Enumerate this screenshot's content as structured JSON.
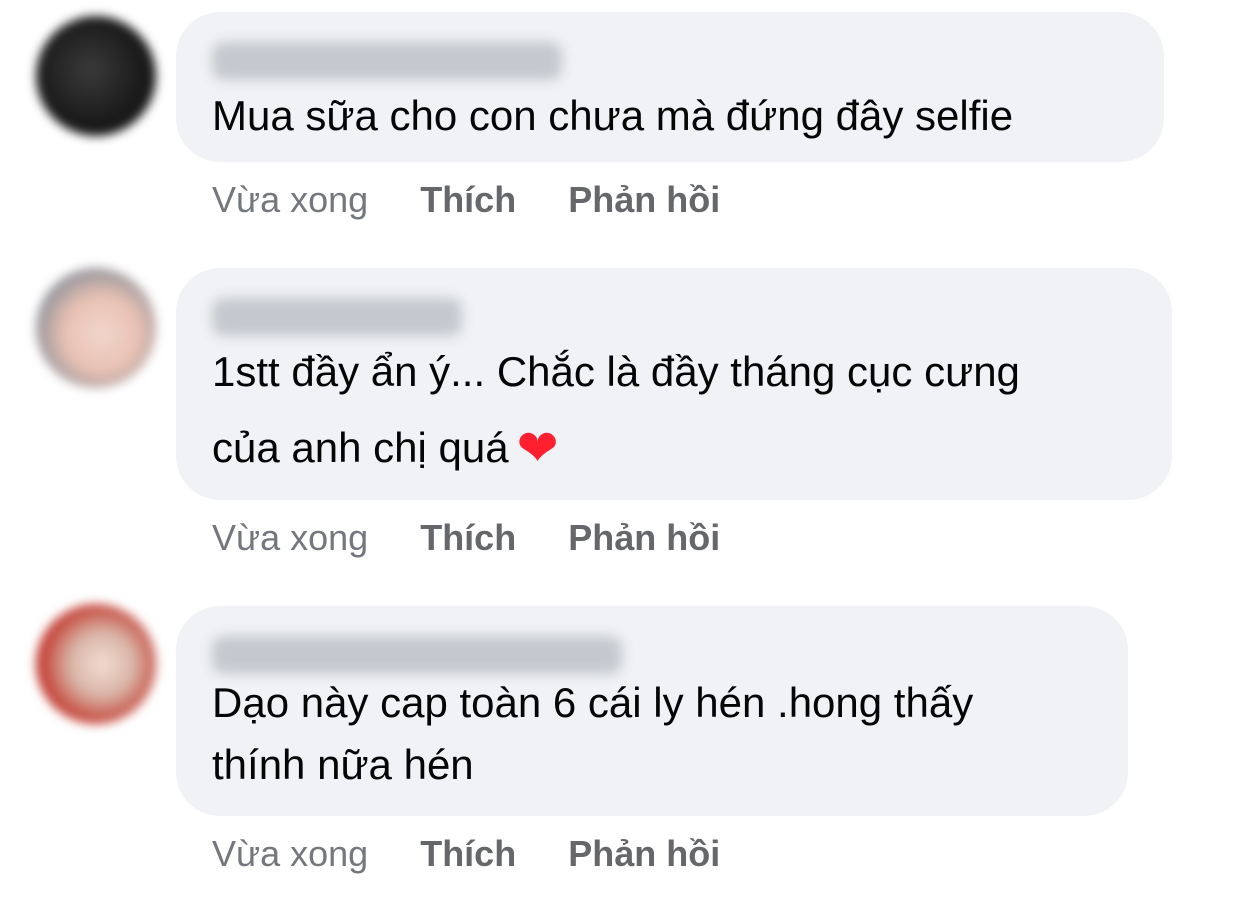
{
  "comments": [
    {
      "text": "Mua sữa cho con chưa mà đứng đây selfie",
      "time": "Vừa xong",
      "like_label": "Thích",
      "reply_label": "Phản hồi"
    },
    {
      "text": "1stt đầy ẩn ý... Chắc là đầy tháng cục cưng\ncủa anh chị quá",
      "emoji": "❤",
      "time": "Vừa xong",
      "like_label": "Thích",
      "reply_label": "Phản hồi"
    },
    {
      "text": "Dạo này cap toàn 6 cái ly hén .hong thấy\nthính nữa hén",
      "time": "Vừa xong",
      "like_label": "Thích",
      "reply_label": "Phản hồi"
    }
  ],
  "colors": {
    "bubble": "#f0f2f5",
    "text": "#050505",
    "action": "#65676b",
    "heart": "#ff1f2e"
  }
}
